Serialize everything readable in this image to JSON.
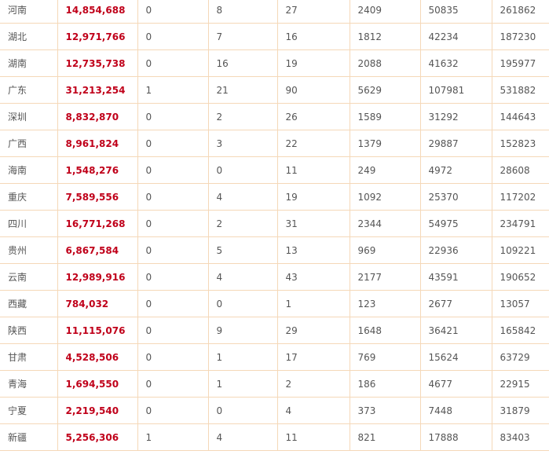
{
  "rows": [
    {
      "region": "河南",
      "amount": "14,854,688",
      "c1": "0",
      "c2": "8",
      "c3": "27",
      "c4": "2409",
      "c5": "50835",
      "c6": "261862"
    },
    {
      "region": "湖北",
      "amount": "12,971,766",
      "c1": "0",
      "c2": "7",
      "c3": "16",
      "c4": "1812",
      "c5": "42234",
      "c6": "187230"
    },
    {
      "region": "湖南",
      "amount": "12,735,738",
      "c1": "0",
      "c2": "16",
      "c3": "19",
      "c4": "2088",
      "c5": "41632",
      "c6": "195977"
    },
    {
      "region": "广东",
      "amount": "31,213,254",
      "c1": "1",
      "c2": "21",
      "c3": "90",
      "c4": "5629",
      "c5": "107981",
      "c6": "531882"
    },
    {
      "region": "深圳",
      "amount": "8,832,870",
      "c1": "0",
      "c2": "2",
      "c3": "26",
      "c4": "1589",
      "c5": "31292",
      "c6": "144643"
    },
    {
      "region": "广西",
      "amount": "8,961,824",
      "c1": "0",
      "c2": "3",
      "c3": "22",
      "c4": "1379",
      "c5": "29887",
      "c6": "152823"
    },
    {
      "region": "海南",
      "amount": "1,548,276",
      "c1": "0",
      "c2": "0",
      "c3": "11",
      "c4": "249",
      "c5": "4972",
      "c6": "28608"
    },
    {
      "region": "重庆",
      "amount": "7,589,556",
      "c1": "0",
      "c2": "4",
      "c3": "19",
      "c4": "1092",
      "c5": "25370",
      "c6": "117202"
    },
    {
      "region": "四川",
      "amount": "16,771,268",
      "c1": "0",
      "c2": "2",
      "c3": "31",
      "c4": "2344",
      "c5": "54975",
      "c6": "234791"
    },
    {
      "region": "贵州",
      "amount": "6,867,584",
      "c1": "0",
      "c2": "5",
      "c3": "13",
      "c4": "969",
      "c5": "22936",
      "c6": "109221"
    },
    {
      "region": "云南",
      "amount": "12,989,916",
      "c1": "0",
      "c2": "4",
      "c3": "43",
      "c4": "2177",
      "c5": "43591",
      "c6": "190652"
    },
    {
      "region": "西藏",
      "amount": "784,032",
      "c1": "0",
      "c2": "0",
      "c3": "1",
      "c4": "123",
      "c5": "2677",
      "c6": "13057"
    },
    {
      "region": "陕西",
      "amount": "11,115,076",
      "c1": "0",
      "c2": "9",
      "c3": "29",
      "c4": "1648",
      "c5": "36421",
      "c6": "165842"
    },
    {
      "region": "甘肃",
      "amount": "4,528,506",
      "c1": "0",
      "c2": "1",
      "c3": "17",
      "c4": "769",
      "c5": "15624",
      "c6": "63729"
    },
    {
      "region": "青海",
      "amount": "1,694,550",
      "c1": "0",
      "c2": "1",
      "c3": "2",
      "c4": "186",
      "c5": "4677",
      "c6": "22915"
    },
    {
      "region": "宁夏",
      "amount": "2,219,540",
      "c1": "0",
      "c2": "0",
      "c3": "4",
      "c4": "373",
      "c5": "7448",
      "c6": "31879"
    },
    {
      "region": "新疆",
      "amount": "5,256,306",
      "c1": "1",
      "c2": "4",
      "c3": "11",
      "c4": "821",
      "c5": "17888",
      "c6": "83403"
    }
  ]
}
